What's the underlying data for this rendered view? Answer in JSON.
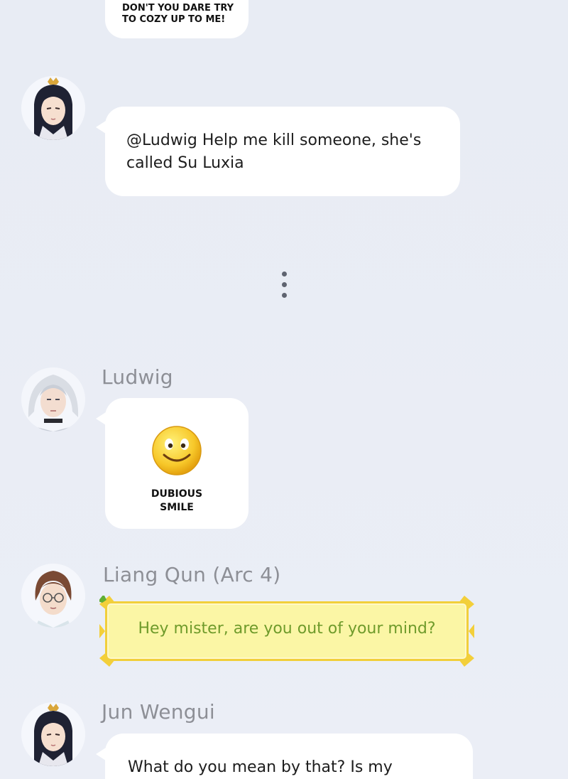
{
  "colors": {
    "background": "#e9edf5",
    "bubble": "#ffffff",
    "sender_name": "#8d8f96",
    "gold_bubble_fill": "#fbf6a5",
    "gold_bubble_border": "#f1cf3a",
    "gold_bubble_text": "#6f9b2b"
  },
  "messages": [
    {
      "id": "m0",
      "type": "text-caps",
      "text_line1": "DON'T YOU DARE TRY",
      "text_line2": "TO COZY UP TO ME!"
    },
    {
      "id": "m1",
      "type": "text",
      "avatar_icon": "black-haired-man-with-crown-avatar",
      "line1": "@Ludwig Help me kill someone, she's",
      "line2": "called Su Luxia"
    },
    {
      "id": "separator",
      "type": "vertical-ellipsis",
      "icon": "vertical-dots-icon"
    },
    {
      "id": "m2",
      "type": "sticker",
      "sender": "Ludwig",
      "avatar_icon": "white-haired-man-avatar",
      "sticker_icon": "smiley-face-emoji",
      "caption_line1": "DUBIOUS",
      "caption_line2": "SMILE"
    },
    {
      "id": "m3",
      "type": "gold-text",
      "sender": "Liang Qun (Arc 4)",
      "avatar_icon": "brown-haired-man-with-glasses-avatar",
      "text": "Hey mister, are you out of your mind?"
    },
    {
      "id": "m4",
      "type": "text",
      "sender": "Jun Wengui",
      "avatar_icon": "black-haired-man-with-crown-avatar",
      "line1": "What do you mean by that? Is my"
    }
  ]
}
